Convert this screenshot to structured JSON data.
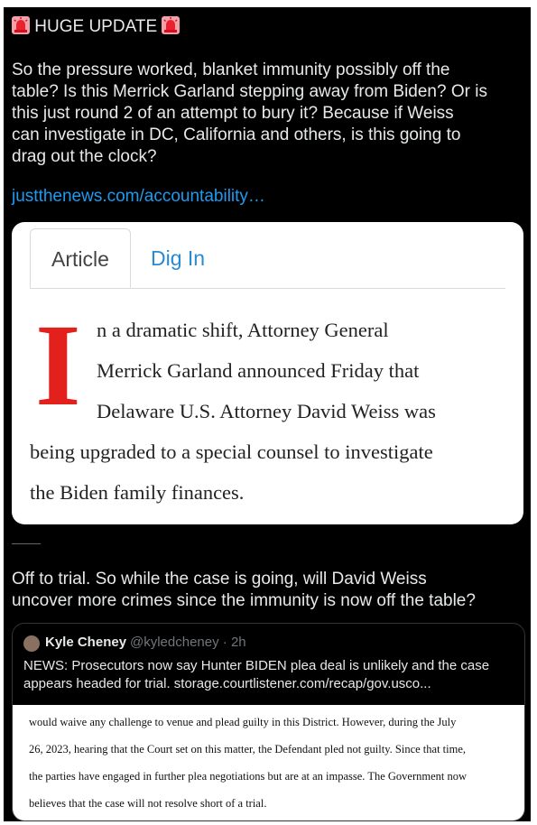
{
  "post": {
    "headline": "HUGE UPDATE",
    "body_lines": [
      "So the pressure worked, blanket immunity possibly off the",
      "table? Is this Merrick Garland stepping away from Biden? Or is",
      "this just round 2 of an attempt to bury it? Because if Weiss",
      "can investigate in DC, California and others, is this going to",
      "drag out the clock?"
    ],
    "link": "justthenews.com/accountability…"
  },
  "article_card": {
    "tab_article": "Article",
    "tab_dig_in": "Dig In",
    "drop_cap": "I",
    "lines": [
      "n a dramatic shift, Attorney General",
      "Merrick Garland announced Friday that",
      "Delaware U.S. Attorney David Weiss was",
      "being upgraded to a special counsel to investigate",
      "the Biden family finances."
    ]
  },
  "reply": {
    "lines": [
      "Off to trial. So while the case is going, will David Weiss",
      "uncover more crimes since the immunity is now off the table?"
    ]
  },
  "quoted_tweet": {
    "name": "Kyle Cheney",
    "handle": "@kyledcheney · 2h",
    "text_lines": [
      "NEWS: Prosecutors now say Hunter BIDEN plea deal is unlikely and the case",
      "appears headed for trial. storage.courtlistener.com/recap/gov.usco..."
    ],
    "document_lines": [
      "would waive any challenge to venue and plead guilty in this District.  However, during the July",
      "26, 2023, hearing that the Court set on this matter, the Defendant pled not guilty.  Since that time,",
      "the parties have engaged in further plea negotiations but are at an impasse.  The Government now",
      "believes that the case will not resolve short of a trial."
    ]
  },
  "colors": {
    "background": "#000000",
    "link": "#1d9bf0",
    "drop_cap": "#e2201c",
    "tab_dig_in": "#2a8ad0"
  },
  "icons": [
    "siren-icon",
    "siren-icon"
  ]
}
